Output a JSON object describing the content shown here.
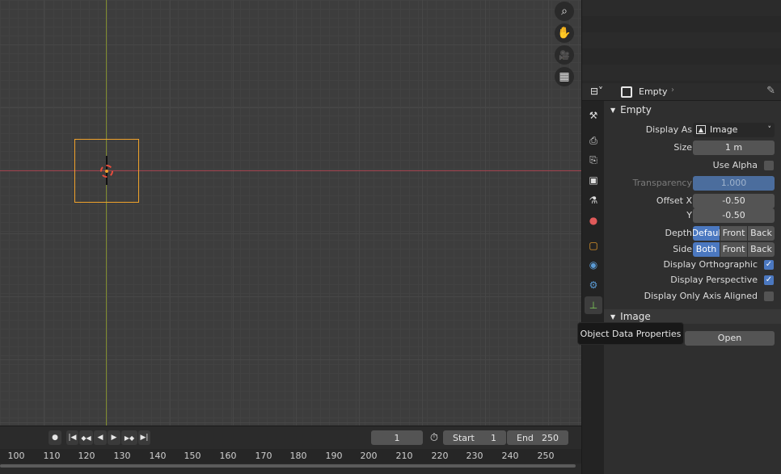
{
  "viewport": {
    "nav": [
      {
        "name": "zoom-icon",
        "glyph": "⌕"
      },
      {
        "name": "pan-hand-icon",
        "glyph": "✋"
      },
      {
        "name": "camera-icon",
        "glyph": "🎥"
      },
      {
        "name": "grid-icon",
        "glyph": "▦"
      }
    ]
  },
  "timeline": {
    "current_frame": "1",
    "start_label": "Start",
    "start_value": "1",
    "end_label": "End",
    "end_value": "250",
    "transport": [
      "●",
      "|◀",
      "◆◀",
      "◀",
      "▶",
      "▶◆",
      "▶|"
    ],
    "ticks": [
      "100",
      "110",
      "120",
      "130",
      "140",
      "150",
      "160",
      "170",
      "180",
      "190",
      "200",
      "210",
      "220",
      "230",
      "240",
      "250"
    ]
  },
  "properties": {
    "header": {
      "breadcrumb_object": "Empty"
    },
    "empty_panel": {
      "title": "Empty",
      "display_as_label": "Display As",
      "display_as_value": "Image",
      "size_label": "Size",
      "size_value": "1 m",
      "use_alpha_label": "Use Alpha",
      "transparency_label": "Transparency",
      "transparency_value": "1.000",
      "offset_x_label": "Offset X",
      "offset_x_value": "-0.50",
      "offset_y_label": "Y",
      "offset_y_value": "-0.50",
      "depth_label": "Depth",
      "depth_options": [
        "Defaul",
        "Front",
        "Back"
      ],
      "side_label": "Side",
      "side_options": [
        "Both",
        "Front",
        "Back"
      ],
      "display_ortho_label": "Display Orthographic",
      "display_persp_label": "Display Perspective",
      "display_axis_label": "Display Only Axis Aligned"
    },
    "image_panel": {
      "title": "Image",
      "open_label": "Open"
    },
    "tooltip": "Object Data Properties"
  },
  "colors": {
    "accent": "#4b78c0",
    "object_outline": "#f0a22b",
    "x_axis": "#a3444f",
    "y_axis": "#7f8b2e"
  }
}
